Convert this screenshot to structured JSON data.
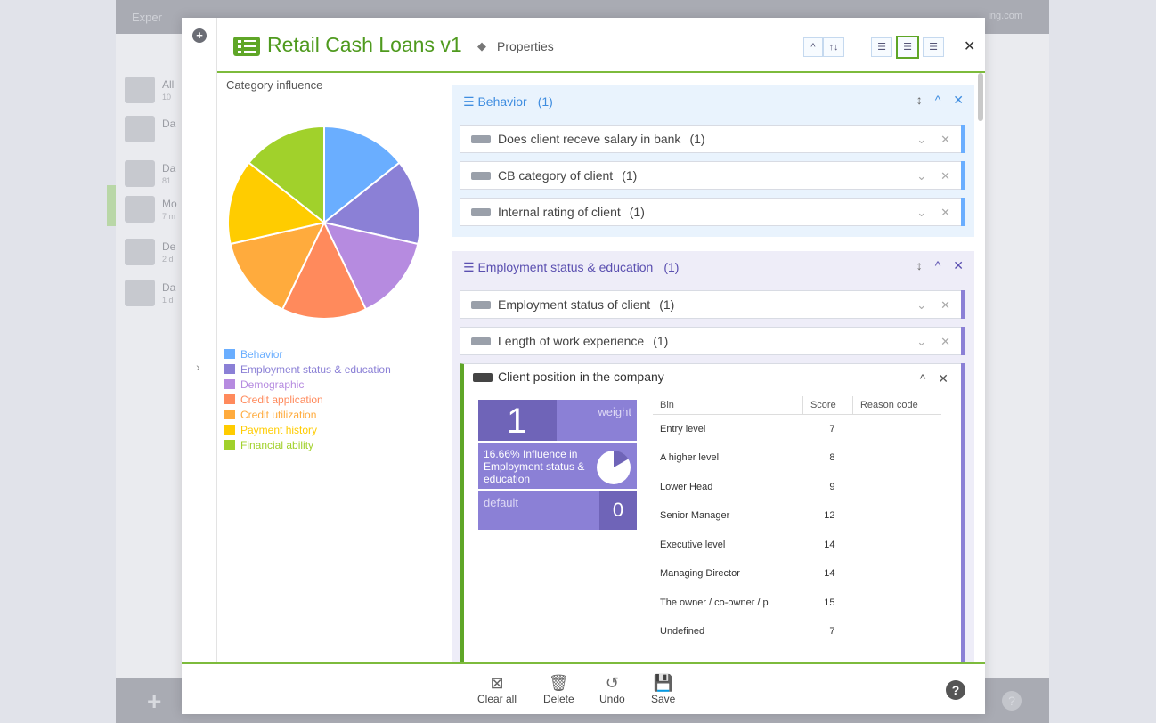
{
  "background": {
    "app_title": "Exper",
    "right_text": "ing.com",
    "nav": [
      {
        "title": "All",
        "sub": "10"
      },
      {
        "title": "Da",
        "sub": ""
      },
      {
        "title": "Da",
        "sub": "81"
      },
      {
        "title": "Mo",
        "sub": "7 m"
      },
      {
        "title": "De",
        "sub": "2 d"
      },
      {
        "title": "Da",
        "sub": "1 d"
      }
    ]
  },
  "header": {
    "title": "Retail Cash Loans v1",
    "properties_label": "Properties",
    "sort_up": "^",
    "sort_toggle": "↑↓",
    "view_compact": "☰",
    "view_normal": "☰",
    "view_detailed": "☰",
    "close": "✕"
  },
  "left_panel": {
    "title": "Category influence",
    "legend": [
      {
        "label": "Behavior",
        "color": "#6aaeff"
      },
      {
        "label": "Employment status & education",
        "color": "#8b80d6"
      },
      {
        "label": "Demographic",
        "color": "#b68be0"
      },
      {
        "label": "Credit application",
        "color": "#ff8a5c"
      },
      {
        "label": "Credit utilization",
        "color": "#ffab3d"
      },
      {
        "label": "Payment history",
        "color": "#ffcc00"
      },
      {
        "label": "Financial ability",
        "color": "#a1d12b"
      }
    ]
  },
  "categories": [
    {
      "name": "Behavior",
      "count": "(1)",
      "accent": "#6aaeff",
      "characteristics": [
        {
          "label": "Does client receve salary in bank",
          "count": "(1)"
        },
        {
          "label": "CB category of client",
          "count": "(1)"
        },
        {
          "label": "Internal rating of client",
          "count": "(1)"
        }
      ]
    },
    {
      "name": "Employment status & education",
      "count": "(1)",
      "accent": "#8b80d6",
      "characteristics": [
        {
          "label": "Employment status of client",
          "count": "(1)"
        },
        {
          "label": "Length of work experience",
          "count": "(1)"
        }
      ]
    }
  ],
  "expanded": {
    "title": "Client position in the company",
    "weight_value": "1",
    "weight_label": "weight",
    "influence_text": "16.66% Influence in Employment status & education",
    "influence_fraction": 0.1666,
    "default_label": "default",
    "default_value": "0",
    "columns": [
      "Bin",
      "Score",
      "Reason code"
    ],
    "bins": [
      {
        "bin": "Entry level",
        "score": "7",
        "reason": ""
      },
      {
        "bin": "A higher level",
        "score": "8",
        "reason": ""
      },
      {
        "bin": "Lower Head",
        "score": "9",
        "reason": ""
      },
      {
        "bin": "Senior Manager",
        "score": "12",
        "reason": ""
      },
      {
        "bin": "Executive level",
        "score": "14",
        "reason": ""
      },
      {
        "bin": "Managing Director",
        "score": "14",
        "reason": ""
      },
      {
        "bin": "The owner / co-owner / p",
        "score": "15",
        "reason": ""
      },
      {
        "bin": "Undefined",
        "score": "7",
        "reason": ""
      }
    ]
  },
  "footer": {
    "clear_all": "Clear all",
    "delete": "Delete",
    "undo": "Undo",
    "save": "Save",
    "help": "?"
  },
  "chart_data": {
    "type": "pie",
    "title": "Category influence",
    "categories": [
      "Behavior",
      "Employment status & education",
      "Demographic",
      "Credit application",
      "Credit utilization",
      "Payment history",
      "Financial ability"
    ],
    "values": [
      14.29,
      14.29,
      14.29,
      14.29,
      14.29,
      14.29,
      14.29
    ],
    "colors": [
      "#6aaeff",
      "#8b80d6",
      "#b68be0",
      "#ff8a5c",
      "#ffab3d",
      "#ffcc00",
      "#a1d12b"
    ],
    "legend": "bottom-left"
  }
}
